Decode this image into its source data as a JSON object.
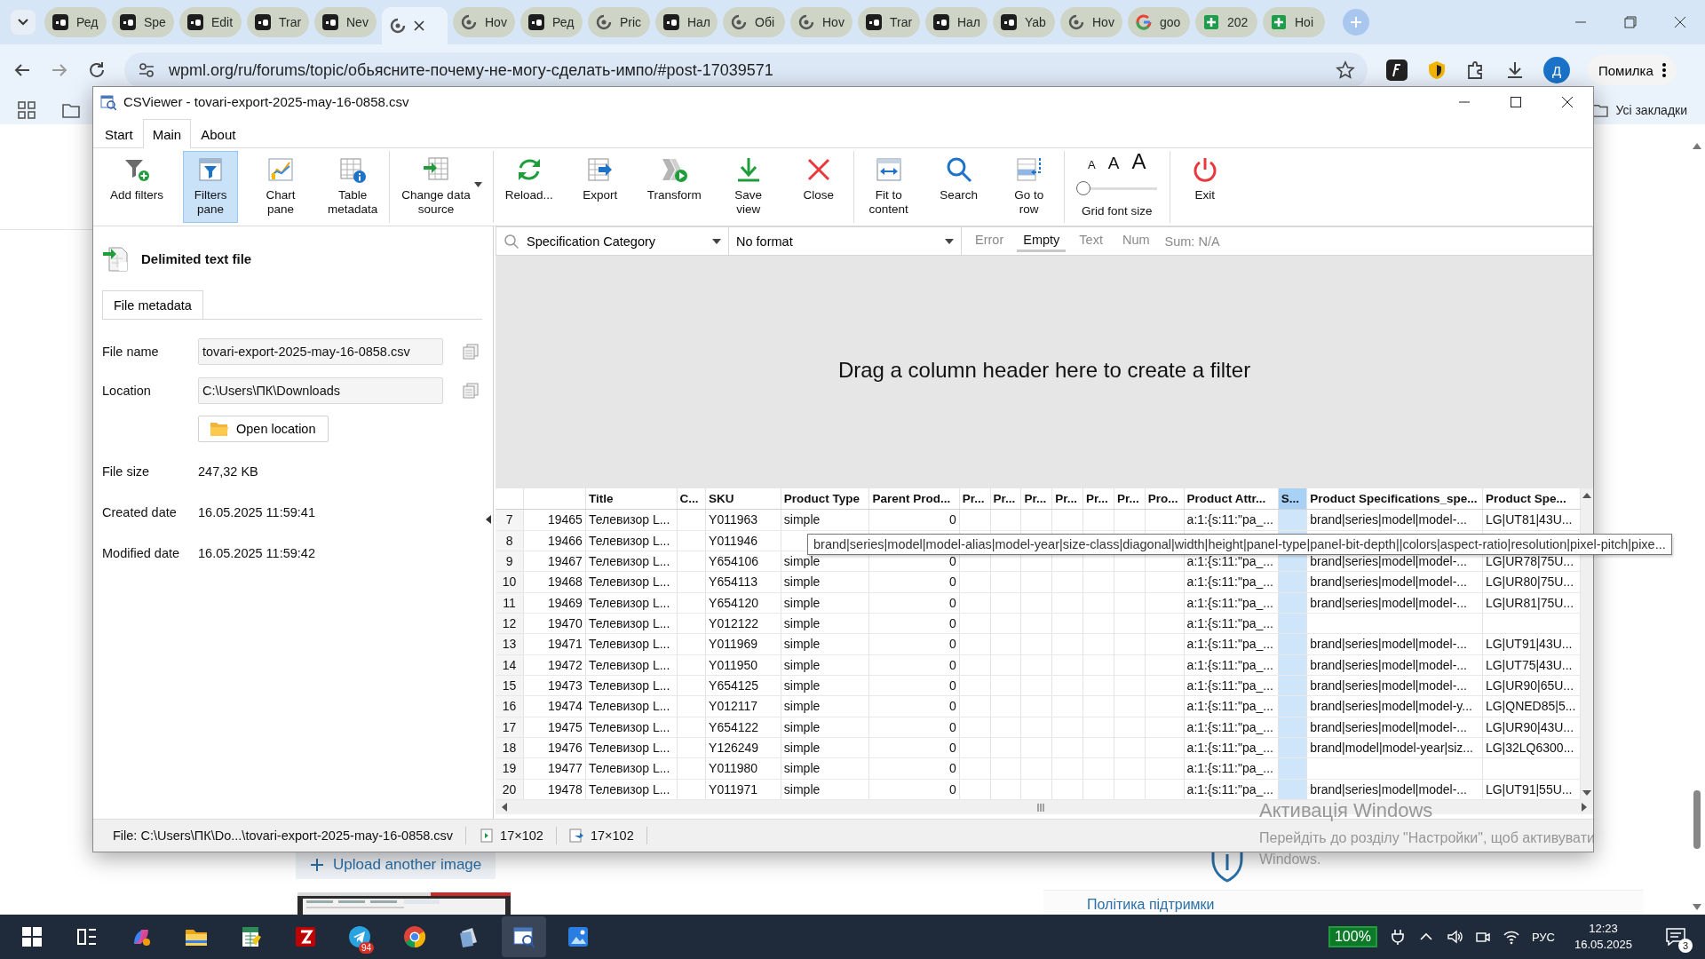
{
  "browser": {
    "tabs": [
      {
        "kind": "ua",
        "title": "Ред",
        "selected": false
      },
      {
        "kind": "ua",
        "title": "Spe",
        "selected": false
      },
      {
        "kind": "ua",
        "title": "Edit",
        "selected": false
      },
      {
        "kind": "ua",
        "title": "Trar",
        "selected": false
      },
      {
        "kind": "ua",
        "title": "Nev",
        "selected": false
      },
      {
        "kind": "wpml",
        "selected": true
      },
      {
        "kind": "wpml",
        "title": "Hov",
        "selected": false
      },
      {
        "kind": "ua",
        "title": "Ред",
        "selected": false
      },
      {
        "kind": "wpml",
        "title": "Pric",
        "selected": false
      },
      {
        "kind": "ua",
        "title": "Нал",
        "selected": false
      },
      {
        "kind": "wpml",
        "title": "Обі",
        "selected": false
      },
      {
        "kind": "wpml",
        "title": "Hov",
        "selected": false
      },
      {
        "kind": "ua",
        "title": "Trar",
        "selected": false
      },
      {
        "kind": "ua",
        "title": "Нал",
        "selected": false
      },
      {
        "kind": "ua",
        "title": "Yab",
        "selected": false
      },
      {
        "kind": "wpml",
        "title": "Hov",
        "selected": false
      },
      {
        "kind": "google",
        "title": "goo",
        "selected": false
      },
      {
        "kind": "sheets",
        "title": "202",
        "selected": false
      },
      {
        "kind": "sheets",
        "title": "Ноі",
        "selected": false
      }
    ],
    "address": "wpml.org/ru/forums/topic/обьясните-почему-не-могу-сделать-импо/#post-17039571",
    "profile": "Д",
    "error_button": "Помилка",
    "bookmarks_label": "Усі закладки"
  },
  "web_page": {
    "upload_button": "Upload another image",
    "support_link": "Політика підтримки"
  },
  "app": {
    "title": "CSViewer - tovari-export-2025-may-16-0858.csv",
    "menu_tabs": [
      {
        "label": "Start",
        "selected": false
      },
      {
        "label": "Main",
        "selected": true
      },
      {
        "label": "About",
        "selected": false
      }
    ],
    "ribbon": [
      {
        "buttons": [
          {
            "kind": "button",
            "lines": [
              "Add filters"
            ],
            "selected": false,
            "dropdown": false
          },
          {
            "kind": "button",
            "lines": [
              "Filters",
              "pane"
            ],
            "selected": true,
            "dropdown": false
          },
          {
            "kind": "button",
            "lines": [
              "Chart",
              "pane"
            ],
            "selected": false,
            "dropdown": false
          },
          {
            "kind": "button",
            "lines": [
              "Table",
              "metadata"
            ],
            "selected": false,
            "dropdown": false
          }
        ]
      },
      {
        "buttons": [
          {
            "kind": "button",
            "lines": [
              "Change data",
              "source"
            ],
            "selected": false,
            "dropdown": true
          }
        ]
      },
      {
        "buttons": [
          {
            "kind": "button",
            "lines": [
              "Reload..."
            ],
            "selected": false,
            "dropdown": false
          },
          {
            "kind": "button",
            "lines": [
              "Export"
            ],
            "selected": false,
            "dropdown": false
          },
          {
            "kind": "button",
            "lines": [
              "Transform"
            ],
            "selected": false,
            "dropdown": false
          },
          {
            "kind": "button",
            "lines": [
              "Save",
              "view"
            ],
            "selected": false,
            "dropdown": false
          },
          {
            "kind": "button",
            "lines": [
              "Close"
            ],
            "selected": false,
            "dropdown": false
          }
        ]
      },
      {
        "buttons": [
          {
            "kind": "button",
            "lines": [
              "Fit to",
              "content"
            ],
            "selected": false,
            "dropdown": false
          },
          {
            "kind": "button",
            "lines": [
              "Search"
            ],
            "selected": false,
            "dropdown": false
          },
          {
            "kind": "button",
            "lines": [
              "Go to",
              "row"
            ],
            "selected": false,
            "dropdown": false
          }
        ]
      },
      {
        "buttons": [
          {
            "kind": "font_size",
            "lines": [
              "Grid font size"
            ],
            "sizes": [
              "A",
              "A",
              "A"
            ],
            "level": 0
          }
        ]
      },
      {
        "buttons": [
          {
            "kind": "button",
            "lines": [
              "Exit"
            ],
            "selected": false,
            "dropdown": false
          }
        ]
      }
    ],
    "left_pane": {
      "heading": "Delimited text file",
      "tab": "File metadata",
      "fields": [
        {
          "kind": "field",
          "label": "File name",
          "value": "tovari-export-2025-may-16-0858.csv"
        },
        {
          "kind": "field",
          "label": "Location",
          "value": "C:\\Users\\ПК\\Downloads"
        },
        {
          "kind": "button",
          "value": "Open location"
        },
        {
          "kind": "text",
          "label": "File size",
          "value": "247,32 KB"
        },
        {
          "kind": "text",
          "label": "Created date",
          "value": "16.05.2025 11:59:41"
        },
        {
          "kind": "text",
          "label": "Modified date",
          "value": "16.05.2025 11:59:42"
        }
      ]
    },
    "filter_bar": {
      "column": "Specification Category",
      "format": "No format",
      "tabs": [
        {
          "label": "Error",
          "selected": false
        },
        {
          "label": "Empty",
          "selected": true
        },
        {
          "label": "Text",
          "selected": false
        },
        {
          "label": "Num",
          "selected": false
        }
      ],
      "sum": "Sum: N/A"
    },
    "drop_hint": "Drag a column header here to create a filter",
    "grid": {
      "columns": [
        {
          "selected": false
        },
        {
          "label": "Title",
          "selected": false
        },
        {
          "label": "C...",
          "selected": false
        },
        {
          "label": "SKU",
          "selected": false
        },
        {
          "label": "Product Type",
          "selected": false
        },
        {
          "label": "Parent Prod...",
          "selected": false
        },
        {
          "label": "Pr...",
          "selected": false
        },
        {
          "label": "Pr...",
          "selected": false
        },
        {
          "label": "Pr...",
          "selected": false
        },
        {
          "label": "Pr...",
          "selected": false
        },
        {
          "label": "Pr...",
          "selected": false
        },
        {
          "label": "Pr...",
          "selected": false
        },
        {
          "label": "Pro...",
          "selected": false
        },
        {
          "label": "Product Attr...",
          "selected": false
        },
        {
          "label": "S...",
          "selected": true
        },
        {
          "label": "Product Specifications_spe...",
          "selected": false
        },
        {
          "label": "Product Spe...",
          "selected": false
        }
      ],
      "rows": [
        {
          "number": "7",
          "id": "19465",
          "title": "Телевизор L...",
          "sku": "Y011963",
          "product_type": "simple",
          "parent_prod": "0",
          "product_attr": "a:1:{s:11:\"pa_...",
          "product_specifications_spe": "brand|series|model|model-...",
          "product_spe": "LG|UT81|43U..."
        },
        {
          "number": "8",
          "id": "19466",
          "title": "Телевизор L...",
          "sku": "Y011946"
        },
        {
          "number": "9",
          "id": "19467",
          "title": "Телевизор L...",
          "sku": "Y654106",
          "product_type": "simple",
          "parent_prod": "0",
          "product_attr": "a:1:{s:11:\"pa_...",
          "product_specifications_spe": "brand|series|model|model-...",
          "product_spe": "LG|UR78|75U..."
        },
        {
          "number": "10",
          "id": "19468",
          "title": "Телевизор L...",
          "sku": "Y654113",
          "product_type": "simple",
          "parent_prod": "0",
          "product_attr": "a:1:{s:11:\"pa_...",
          "product_specifications_spe": "brand|series|model|model-...",
          "product_spe": "LG|UR80|75U..."
        },
        {
          "number": "11",
          "id": "19469",
          "title": "Телевизор L...",
          "sku": "Y654120",
          "product_type": "simple",
          "parent_prod": "0",
          "product_attr": "a:1:{s:11:\"pa_...",
          "product_specifications_spe": "brand|series|model|model-...",
          "product_spe": "LG|UR81|75U..."
        },
        {
          "number": "12",
          "id": "19470",
          "title": "Телевизор L...",
          "sku": "Y012122",
          "product_type": "simple",
          "parent_prod": "0",
          "product_attr": "a:1:{s:11:\"pa_..."
        },
        {
          "number": "13",
          "id": "19471",
          "title": "Телевизор L...",
          "sku": "Y011969",
          "product_type": "simple",
          "parent_prod": "0",
          "product_attr": "a:1:{s:11:\"pa_...",
          "product_specifications_spe": "brand|series|model|model-...",
          "product_spe": "LG|UT91|43U..."
        },
        {
          "number": "14",
          "id": "19472",
          "title": "Телевизор L...",
          "sku": "Y011950",
          "product_type": "simple",
          "parent_prod": "0",
          "product_attr": "a:1:{s:11:\"pa_...",
          "product_specifications_spe": "brand|series|model|model-...",
          "product_spe": "LG|UT75|43U..."
        },
        {
          "number": "15",
          "id": "19473",
          "title": "Телевизор L...",
          "sku": "Y654125",
          "product_type": "simple",
          "parent_prod": "0",
          "product_attr": "a:1:{s:11:\"pa_...",
          "product_specifications_spe": "brand|series|model|model-...",
          "product_spe": "LG|UR90|65U..."
        },
        {
          "number": "16",
          "id": "19474",
          "title": "Телевизор L...",
          "sku": "Y012117",
          "product_type": "simple",
          "parent_prod": "0",
          "product_attr": "a:1:{s:11:\"pa_...",
          "product_specifications_spe": "brand|series|model|model-y...",
          "product_spe": "LG|QNED85|5..."
        },
        {
          "number": "17",
          "id": "19475",
          "title": "Телевизор L...",
          "sku": "Y654122",
          "product_type": "simple",
          "parent_prod": "0",
          "product_attr": "a:1:{s:11:\"pa_...",
          "product_specifications_spe": "brand|series|model|model-...",
          "product_spe": "LG|UR90|43U..."
        },
        {
          "number": "18",
          "id": "19476",
          "title": "Телевизор L...",
          "sku": "Y126249",
          "product_type": "simple",
          "parent_prod": "0",
          "product_attr": "a:1:{s:11:\"pa_...",
          "product_specifications_spe": "brand|model|model-year|siz...",
          "product_spe": "LG|32LQ6300..."
        },
        {
          "number": "19",
          "id": "19477",
          "title": "Телевизор L...",
          "sku": "Y011980",
          "product_type": "simple",
          "parent_prod": "0",
          "product_attr": "a:1:{s:11:\"pa_..."
        },
        {
          "number": "20",
          "id": "19478",
          "title": "Телевизор L...",
          "sku": "Y011971",
          "product_type": "simple",
          "parent_prod": "0",
          "product_attr": "a:1:{s:11:\"pa_...",
          "product_specifications_spe": "brand|series|model|model-...",
          "product_spe": "LG|UT91|55U..."
        }
      ],
      "tooltip": "brand|series|model|model-alias|model-year|size-class|diagonal|width|height|panel-type|panel-bit-depth||colors|aspect-ratio|resolution|pixel-pitch|pixe..."
    },
    "status_bar": {
      "file": "File: C:\\Users\\ПК\\Do...\\tovari-export-2025-may-16-0858.csv",
      "counts": [
        "17×102",
        "17×102"
      ]
    }
  },
  "windows_notice": {
    "title": "Активація Windows",
    "text": "Перейдіть до розділу \"Настройки\", щоб активувати Windows."
  },
  "taskbar": {
    "apps": [
      {
        "kind": "start",
        "selected": false
      },
      {
        "kind": "task_view",
        "selected": false
      },
      {
        "kind": "copilot",
        "selected": false
      },
      {
        "kind": "explorer",
        "selected": false
      },
      {
        "kind": "sheet",
        "selected": false
      },
      {
        "kind": "filezilla",
        "selected": false
      },
      {
        "kind": "telegram",
        "selected": false,
        "badge": "94"
      },
      {
        "kind": "chrome",
        "selected": false
      },
      {
        "kind": "notes",
        "selected": false
      },
      {
        "kind": "csviewer",
        "selected": true
      },
      {
        "kind": "photos",
        "selected": false
      }
    ],
    "battery": "100%",
    "language": "РУС",
    "time": "12:23",
    "date": "16.05.2025",
    "notifications": "3"
  }
}
